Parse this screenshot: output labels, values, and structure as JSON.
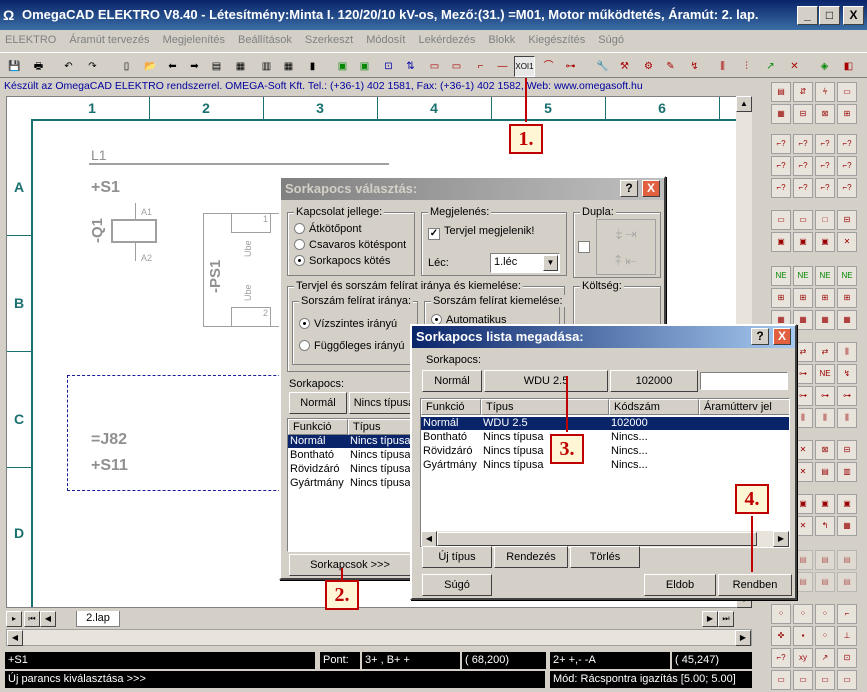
{
  "window": {
    "title": "OmegaCAD ELEKTRO V8.40 - Létesítmény:Minta I. 120/20/10 kV-os, Mező:(31.) =M01, Motor működtetés, Áramút:  2. lap.",
    "icon": "omega-icon",
    "minimize": "_",
    "maximize": "□",
    "close": "X"
  },
  "menu": [
    "ELEKTRO",
    "Áramút tervezés",
    "Megjelenítés",
    "Beállítások",
    "Szerkeszt",
    "Módosít",
    "Lekérdezés",
    "Blokk",
    "Kiegészítés",
    "Súgó"
  ],
  "info_bar": "Készült az OmegaCAD ELEKTRO rendszerrel. OMEGA-Soft Kft. Tel.: (+36-1) 402 1581, Fax: (+36-1) 402 1582, Web: www.omegasoft.hu",
  "toolbar_active_icon": "ΧΟΙ1",
  "drawing": {
    "columns": [
      "1",
      "2",
      "3",
      "4",
      "5",
      "6"
    ],
    "rows": [
      "A",
      "B",
      "C",
      "D"
    ],
    "l1": "L1",
    "s1": "+S1",
    "q1": "-Q1",
    "q1_a1": "A1",
    "q1_a2": "A2",
    "ps1": "-PS1",
    "ps1_ube1": "Ube",
    "ps1_ube2": "Ube",
    "ps1_pin1": "1",
    "ps1_pin2": "2",
    "j82": "=J82",
    "s11": "+S11"
  },
  "dialog1": {
    "title": "Sorkapocs választás:",
    "help": "?",
    "close": "X",
    "kapcsolat_label": "Kapcsolat jellege:",
    "kapcsolat_options": [
      "Átkötőpont",
      "Csavaros kötéspont",
      "Sorkapocs kötés"
    ],
    "kapcsolat_selected": 2,
    "megjelenes_label": "Megjelenés:",
    "tervjel_checkbox": "Tervjel megjelenik!",
    "lec_label": "Léc:",
    "lec_value": "1.léc",
    "dupla_label": "Dupla:",
    "felirat_label": "Tervjel és sorszám felírat iránya és kiemelése:",
    "irany_label": "Sorszám felírat iránya:",
    "irany_options": [
      "Vízszintes irányú",
      "Függőleges irányú"
    ],
    "irany_selected": 0,
    "kiemeles_label": "Sorszám felírat kiemelése:",
    "kiemeles_option": "Automatikus",
    "koltseg_label": "Költség:",
    "sorkapocs_label": "Sorkapocs:",
    "sorkapocs_type": "Normál",
    "sorkapocs_typename": "Nincs típusa",
    "list_headers": [
      "Funkció",
      "Típus"
    ],
    "list_rows": [
      [
        "Normál",
        "Nincs típusa"
      ],
      [
        "Bontható",
        "Nincs típusa"
      ],
      [
        "Rövidzáró",
        "Nincs típusa"
      ],
      [
        "Gyártmány",
        "Nincs típusa"
      ]
    ],
    "sorkapcsok_button": "Sorkapcsok >>>"
  },
  "dialog2": {
    "title": "Sorkapocs lista megadása:",
    "help": "?",
    "close": "X",
    "sorkapocs_label": "Sorkapocs:",
    "field_funkcio": "Normál",
    "field_tipus": "WDU 2.5",
    "field_kodszam": "102000",
    "list_headers": [
      "Funkció",
      "Típus",
      "Kódszám",
      "Áramútterv jel"
    ],
    "list_rows": [
      [
        "Normál",
        "WDU 2.5",
        "102000",
        ""
      ],
      [
        "Bontható",
        "Nincs típusa",
        "Nincs...",
        ""
      ],
      [
        "Rövidzáró",
        "Nincs típusa",
        "Nincs...",
        ""
      ],
      [
        "Gyártmány",
        "Nincs típusa",
        "Nincs...",
        ""
      ]
    ],
    "selected_row": 0,
    "uj_tipus_button": "Új típus",
    "rendezes_button": "Rendezés",
    "torles_button": "Törlés",
    "sugo_button": "Súgó",
    "eldob_button": "Eldob",
    "rendben_button": "Rendben"
  },
  "callouts": [
    "1.",
    "2.",
    "3.",
    "4."
  ],
  "sheet_tab": "2.lap",
  "status": {
    "left_top": "+S1",
    "pont_label": "Pont:",
    "pont_value": "3+   ,  B+ +",
    "pont_coords": "( 68,200)",
    "right_value": "2+ +,- -A",
    "right_coords": "( 45,247)",
    "left_bottom": "Új parancs kiválasztása >>>",
    "mode": "Mód: Rácspontra igazítás  [5.00; 5.00]"
  },
  "colors": {
    "title_blue": "#0a246a",
    "grid_teal": "#1a6f6f",
    "callout_red": "#c00000",
    "selection": "#0a246a"
  }
}
